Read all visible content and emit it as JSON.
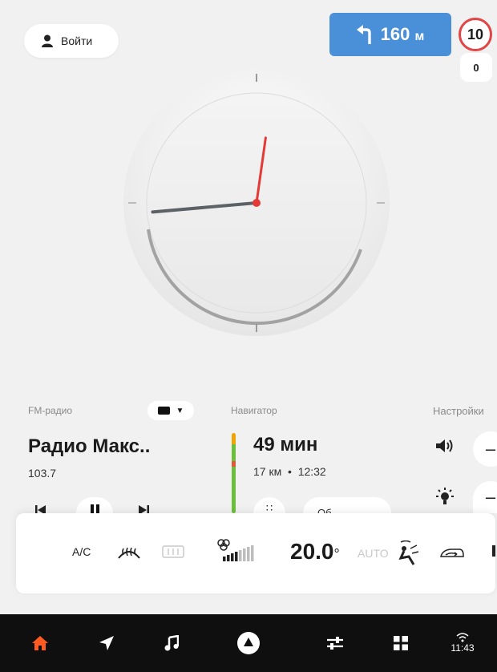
{
  "account": {
    "login_label": "Войти"
  },
  "navigation_hint": {
    "distance_value": "160",
    "distance_unit": "м"
  },
  "speed": {
    "limit": "10",
    "current": "0"
  },
  "clock": {
    "hour_hand_deg": 8,
    "minute_hand_deg": 265
  },
  "radio": {
    "section_label": "FM-радио",
    "station": "Радио Макс..",
    "frequency": "103.7"
  },
  "navigator": {
    "section_label": "Навигатор",
    "eta": "49 мин",
    "distance": "17 км",
    "separator": "•",
    "arrival_time": "12:32",
    "overview_label": "Об"
  },
  "settings": {
    "section_label": "Настройки"
  },
  "climate": {
    "ac_label": "A/C",
    "temperature": "20.0",
    "degree": "°",
    "auto_label": "AUTO"
  },
  "dock": {
    "time": "11:43"
  },
  "colors": {
    "accent_orange": "#ff5a1f",
    "nav_blue": "#4a90d9",
    "speed_red": "#e24545"
  }
}
